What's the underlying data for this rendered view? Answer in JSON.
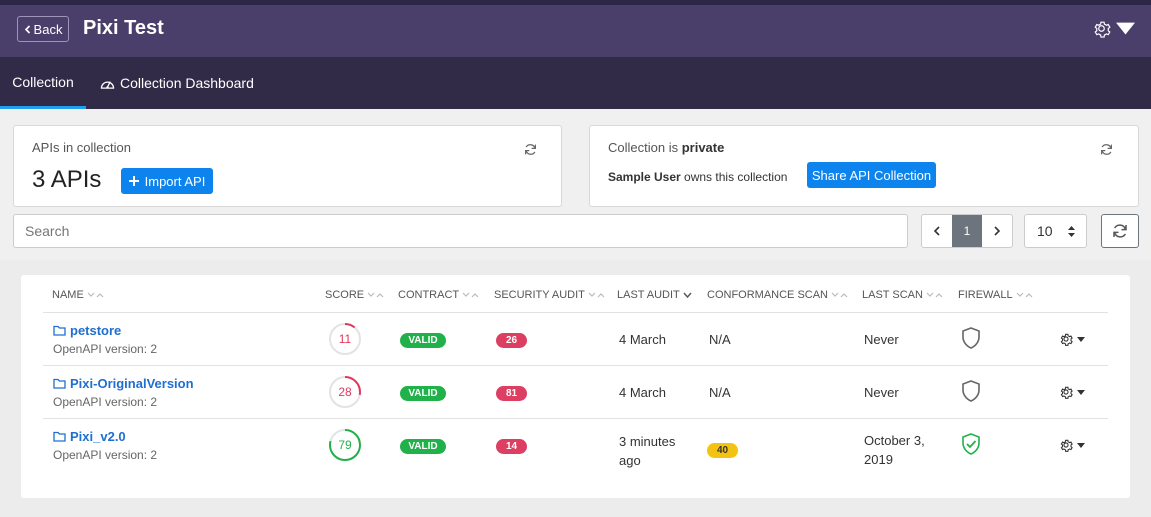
{
  "header": {
    "back_label": "Back",
    "title": "Pixi Test"
  },
  "tabs": [
    {
      "label": "Collection",
      "active": true
    },
    {
      "label": "Collection Dashboard",
      "active": false
    }
  ],
  "summary": {
    "apis_label": "APIs in collection",
    "apis_count": "3 APIs",
    "import_label": "Import API",
    "privacy_prefix": "Collection is",
    "privacy_value": "private",
    "owner_name": "Sample User",
    "owner_suffix": "owns this collection",
    "share_label": "Share API Collection"
  },
  "toolbar": {
    "search_placeholder": "Search",
    "current_page": "1",
    "per_page": "10"
  },
  "table": {
    "columns": [
      "NAME",
      "SCORE",
      "CONTRACT",
      "SECURITY AUDIT",
      "LAST AUDIT",
      "CONFORMANCE SCAN",
      "LAST SCAN",
      "FIREWALL"
    ],
    "rows": [
      {
        "name": "petstore",
        "version": "OpenAPI version: 2",
        "score": "11",
        "score_pct": 0.11,
        "score_color": "#e0395c",
        "contract": "VALID",
        "security_audit": "26",
        "last_audit": "4 March",
        "conformance": "N/A",
        "last_scan": "Never",
        "firewall": "shield-outline"
      },
      {
        "name": "Pixi-OriginalVersion",
        "version": "OpenAPI version: 2",
        "score": "28",
        "score_pct": 0.28,
        "score_color": "#e0395c",
        "contract": "VALID",
        "security_audit": "81",
        "last_audit": "4 March",
        "conformance": "N/A",
        "last_scan": "Never",
        "firewall": "shield-outline"
      },
      {
        "name": "Pixi_v2.0",
        "version": "OpenAPI version: 2",
        "score": "79",
        "score_pct": 0.79,
        "score_color": "#21b14a",
        "contract": "VALID",
        "security_audit": "14",
        "last_audit": "3 minutes ago",
        "conformance": "40",
        "last_scan": "October 3, 2019",
        "firewall": "shield-check"
      }
    ]
  }
}
